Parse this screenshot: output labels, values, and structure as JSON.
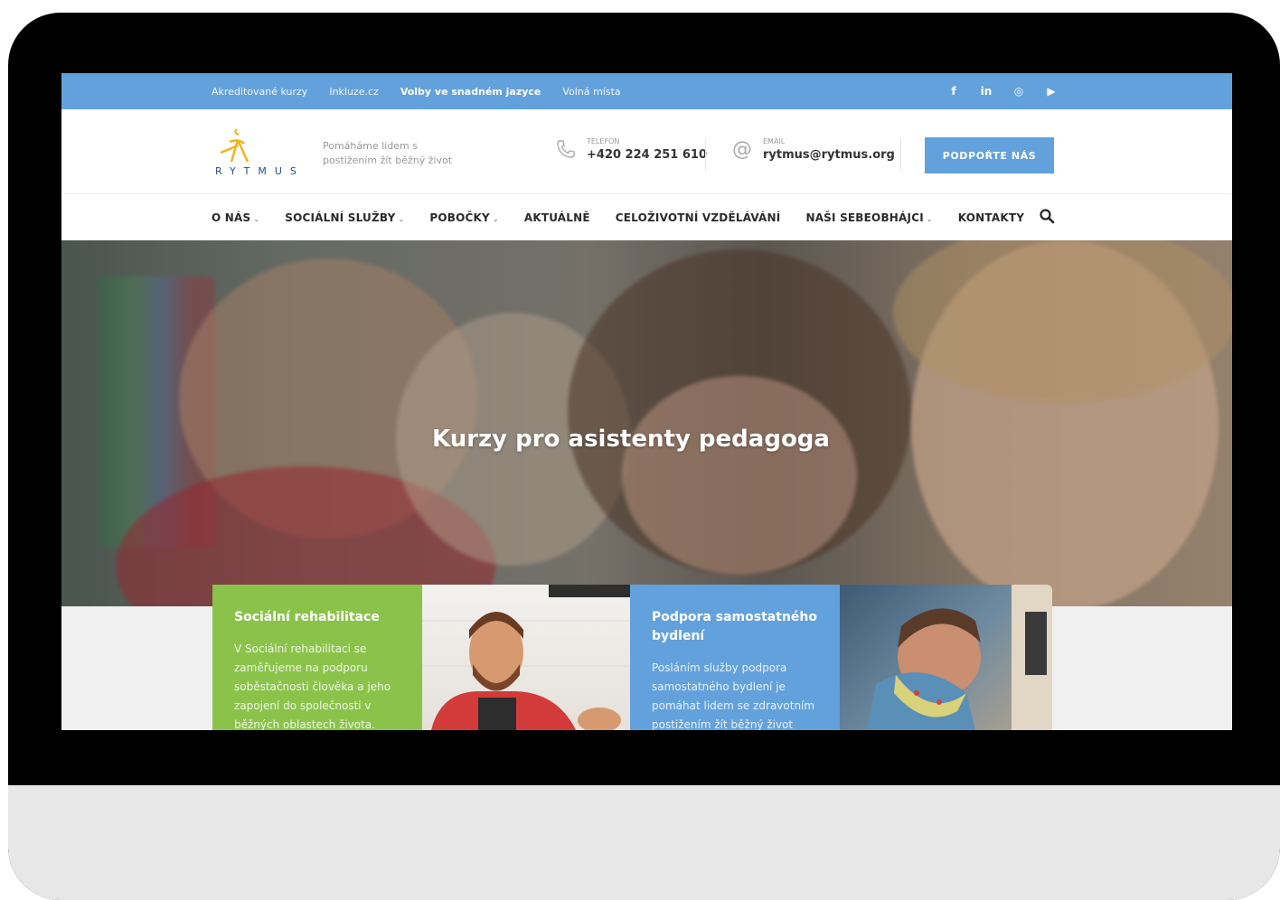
{
  "topbar": {
    "links": [
      "Akreditované kurzy",
      "Inkluze.cz",
      "Volby ve snadném jazyce",
      "Volná místa"
    ],
    "social": [
      "f",
      "in",
      "◎",
      "▶"
    ]
  },
  "header": {
    "logo_text": "RYTMUS",
    "tagline_line1": "Pomáháme lidem s",
    "tagline_line2": "postižením žít běžný život",
    "phone_label": "TELEFON",
    "phone_value": "+420 224 251 610",
    "email_label": "EMAIL",
    "email_value": "rytmus@rytmus.org",
    "support_button": "PODPOŘTE NÁS"
  },
  "nav": {
    "items": [
      {
        "label": "O NÁS",
        "chevron": "⌄"
      },
      {
        "label": "SOCIÁLNÍ SLUŽBY",
        "chevron": "⌄"
      },
      {
        "label": "POBOČKY",
        "chevron": "⌄"
      },
      {
        "label": "AKTUÁLNĚ",
        "chevron": ""
      },
      {
        "label": "CELOŽIVOTNÍ VZDĚLÁVÁNÍ",
        "chevron": ""
      },
      {
        "label": "NAŠI SEBEOBHÁJCI",
        "chevron": "⌄"
      },
      {
        "label": "KONTAKTY",
        "chevron": ""
      }
    ]
  },
  "hero": {
    "title": "Kurzy pro asistenty pedagoga"
  },
  "cards": [
    {
      "title": "Sociální rehabilitace",
      "body": "V Sociální rehabilitaci se zaměřujeme na podporu soběstačnosti člověka a jeho zapojení do společnosti v běžných oblastech života."
    },
    {
      "title": "Podpora samostatného bydlení",
      "body": "Posláním služby podpora samostatného bydlení je pomáhat lidem se zdravotním postižením žít běžný život"
    }
  ],
  "colors": {
    "accent_blue": "#63a1dc",
    "accent_green": "#8bc34a"
  }
}
